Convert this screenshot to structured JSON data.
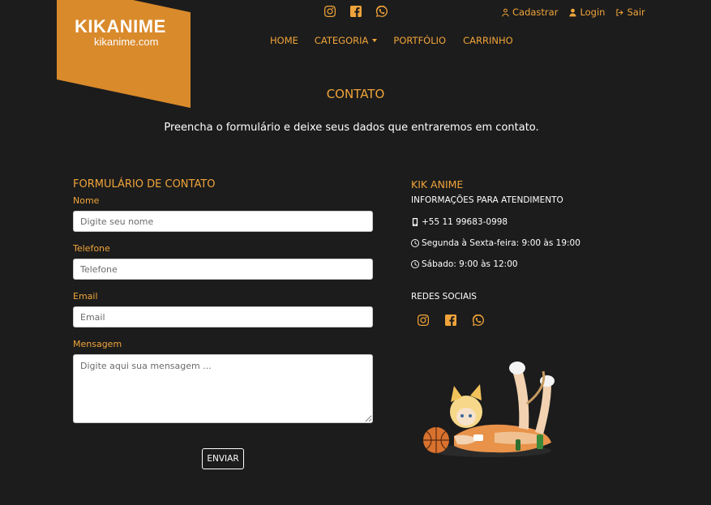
{
  "header": {
    "logo_title": "KIKANIME",
    "logo_sub": "kikanime.com",
    "social_icons": [
      "instagram-icon",
      "facebook-icon",
      "whatsapp-icon"
    ],
    "user_menu": {
      "register": "Cadastrar",
      "login": "Login",
      "logout": "Sair"
    },
    "nav": {
      "home": "HOME",
      "category": "CATEGORIA",
      "portfolio": "PORTFÓLIO",
      "cart": "CARRINHO"
    }
  },
  "page": {
    "title": "CONTATO",
    "subtitle": "Preencha o formulário e deixe seus dados que entraremos em contato."
  },
  "form": {
    "heading": "FORMULÁRIO DE CONTATO",
    "name_label": "Nome",
    "name_placeholder": "Digite seu nome",
    "phone_label": "Telefone",
    "phone_placeholder": "Telefone",
    "email_label": "Email",
    "email_placeholder": "Email",
    "message_label": "Mensagem",
    "message_placeholder": "Digite aqui sua mensagem ...",
    "submit": "ENVIAR"
  },
  "info": {
    "title": "KIK ANIME",
    "subtitle": "INFORMAÇÕES PARA ATENDIMENTO",
    "phone": "+55 11 99683-0998",
    "weekday_hours": "Segunda à Sexta-feira: 9:00 às 19:00",
    "saturday_hours": "Sábado: 9:00 às 12:00",
    "social_title": "REDES SOCIAIS"
  },
  "colors": {
    "background": "#1c1c1c",
    "accent": "#f0a43a",
    "logo": "#d98a2b"
  }
}
